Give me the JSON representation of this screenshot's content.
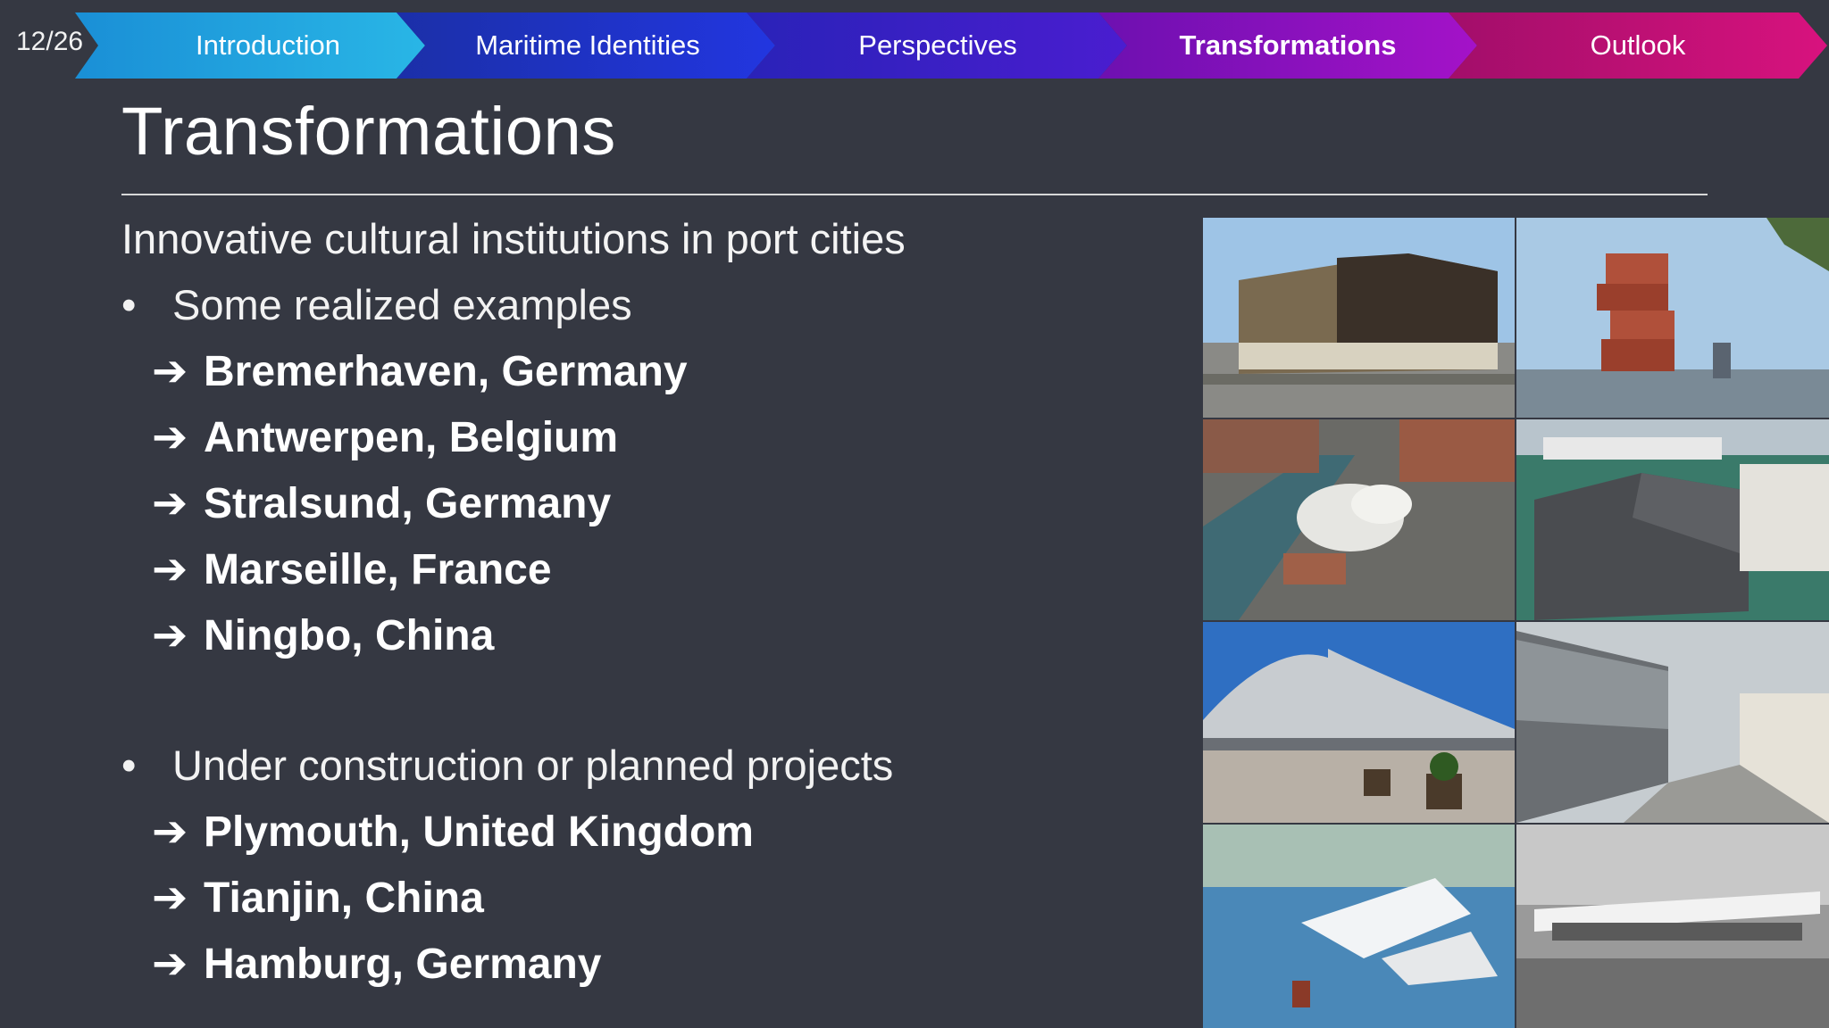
{
  "slide_counter": "12/26",
  "nav": {
    "tabs": [
      {
        "label": "Introduction",
        "active": false,
        "color": "#1fa3dc"
      },
      {
        "label": "Maritime Identities",
        "active": false,
        "color": "#1a2fc8"
      },
      {
        "label": "Perspectives",
        "active": false,
        "color": "#3a1dc0"
      },
      {
        "label": "Transformations",
        "active": true,
        "color": "#8a10b8"
      },
      {
        "label": "Outlook",
        "active": false,
        "color": "#c0106e"
      }
    ]
  },
  "title": "Transformations",
  "subtitle": "Innovative cultural institutions in port cities",
  "sections": [
    {
      "bullet": "Some realized examples",
      "items": [
        "Bremerhaven, Germany",
        "Antwerpen, Belgium",
        "Stralsund, Germany",
        "Marseille, France",
        "Ningbo, China"
      ]
    },
    {
      "bullet": "Under construction or planned projects",
      "items": [
        "Plymouth, United Kingdom",
        "Tianjin, China",
        "Hamburg, Germany"
      ]
    }
  ],
  "arrow_glyph": "➔",
  "bullet_glyph": "•",
  "photos": [
    {
      "name": "bremerhaven-photo"
    },
    {
      "name": "antwerpen-photo"
    },
    {
      "name": "stralsund-photo"
    },
    {
      "name": "marseille-photo"
    },
    {
      "name": "ningbo-photo"
    },
    {
      "name": "plymouth-photo"
    },
    {
      "name": "tianjin-photo"
    },
    {
      "name": "hamburg-photo"
    }
  ]
}
